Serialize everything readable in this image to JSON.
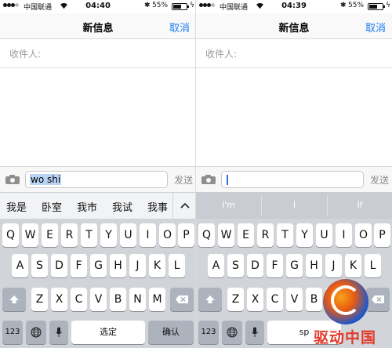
{
  "left": {
    "status": {
      "carrier": "中国联通",
      "time": "04:40",
      "battery": "55%",
      "battery_level": 0.55
    },
    "nav": {
      "title": "新信息",
      "cancel": "取消"
    },
    "recipient_label": "收件人:",
    "compose": {
      "text": "wo shi",
      "send": "发送"
    },
    "candidates": [
      "我是",
      "卧室",
      "我市",
      "我试",
      "我事"
    ],
    "keyboard": {
      "row1": [
        "Q",
        "W",
        "E",
        "R",
        "T",
        "Y",
        "U",
        "I",
        "O",
        "P"
      ],
      "row2": [
        "A",
        "S",
        "D",
        "F",
        "G",
        "H",
        "J",
        "K",
        "L"
      ],
      "row3": [
        "Z",
        "X",
        "C",
        "V",
        "B",
        "N",
        "M"
      ],
      "numbers": "123",
      "space": "选定",
      "return": "确认"
    }
  },
  "right": {
    "status": {
      "carrier": "中国联通",
      "time": "04:39",
      "battery": "55%",
      "battery_level": 0.55
    },
    "nav": {
      "title": "新信息",
      "cancel": "取消"
    },
    "recipient_label": "收件人:",
    "compose": {
      "send": "发送"
    },
    "predictions": [
      "I'm",
      "I",
      "If"
    ],
    "keyboard": {
      "row1": [
        "Q",
        "W",
        "E",
        "R",
        "T",
        "Y",
        "U",
        "I",
        "O",
        "P"
      ],
      "row2": [
        "A",
        "S",
        "D",
        "F",
        "G",
        "H",
        "J",
        "K",
        "L"
      ],
      "row3": [
        "Z",
        "X",
        "C",
        "V",
        "B",
        "N",
        "M"
      ],
      "numbers": "123",
      "space": "sp"
    }
  },
  "watermark": {
    "text": "驱动中国"
  },
  "colors": {
    "accent": "#1f7cf5",
    "keyboard_bg": "#d1d4d9",
    "selection": "#b9d3f2"
  },
  "icons": [
    "camera-icon",
    "globe-icon",
    "microphone-icon",
    "shift-icon",
    "backspace-icon",
    "chevron-up-icon",
    "wifi-icon",
    "bluetooth-icon",
    "battery-icon"
  ]
}
